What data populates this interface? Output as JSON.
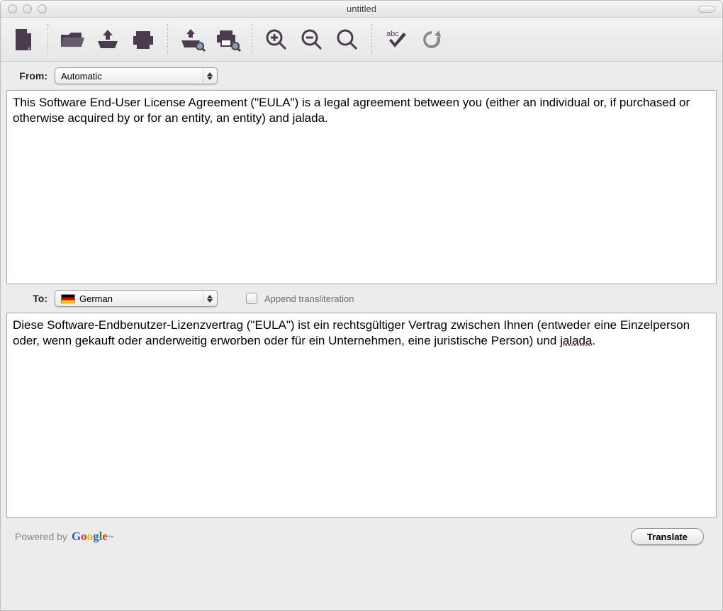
{
  "window": {
    "title": "untitled"
  },
  "toolbar": {
    "icons": [
      "document-icon",
      "open-icon",
      "import-icon",
      "print-icon",
      "import-zoom-icon",
      "print-zoom-icon",
      "zoom-in-icon",
      "zoom-out-icon",
      "search-icon",
      "spellcheck-icon",
      "refresh-icon"
    ]
  },
  "from": {
    "label": "From:",
    "selected": "Automatic",
    "text": "This Software End-User License Agreement (\"EULA\") is a legal agreement between you (either an individual or, if purchased or otherwise acquired by or for an entity, an entity) and jalada."
  },
  "to": {
    "label": "To:",
    "selected": "German",
    "append_checkbox_label": "Append transliteration",
    "append_checked": false,
    "text_pre": "Diese Software-Endbenutzer-Lizenzvertrag (\"EULA\") ist ein rechtsgültiger Vertrag zwischen Ihnen (entweder eine Einzelperson oder, wenn gekauft oder anderweitig erworben oder für ein Unternehmen, eine juristische Person) und ",
    "text_squiggle": "jalada",
    "text_post": "."
  },
  "footer": {
    "powered_by": "Powered by",
    "button": "Translate"
  }
}
